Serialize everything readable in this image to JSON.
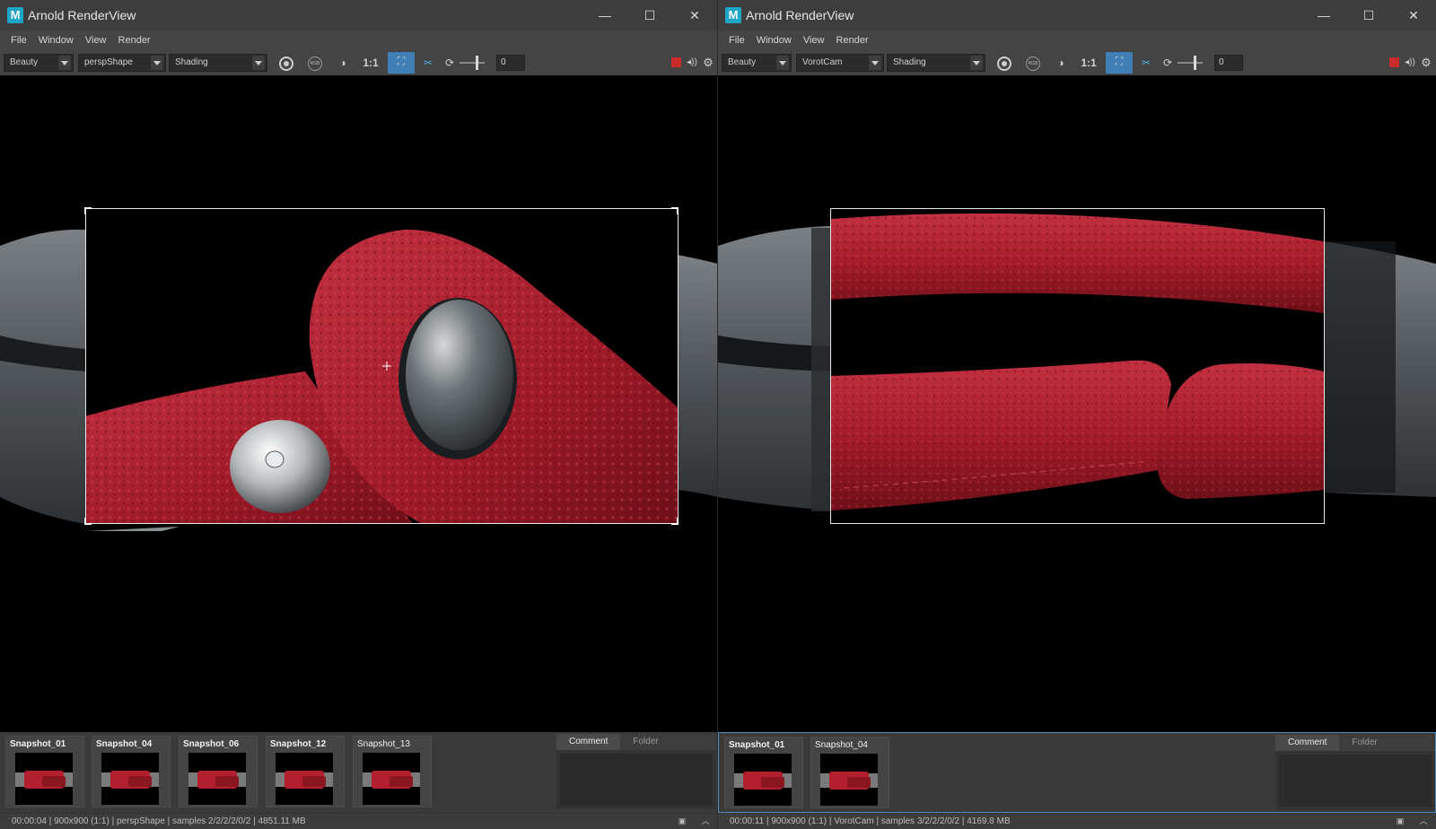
{
  "windows": [
    {
      "title": "Arnold RenderView",
      "logo_letter": "M",
      "window_controls": {
        "minimize": "—",
        "maximize": "☐",
        "close": "✕"
      },
      "menu": [
        "File",
        "Window",
        "View",
        "Render"
      ],
      "toolbar": {
        "aov": "Beauty",
        "camera": "perspShape",
        "debug_shading": "Shading",
        "ratio_label": "1:1",
        "exposure_value": "0"
      },
      "snapshots": [
        "Snapshot_01",
        "Snapshot_04",
        "Snapshot_06",
        "Snapshot_12",
        "Snapshot_13"
      ],
      "comment_tabs": [
        "Comment",
        "Folder"
      ],
      "status": "00:00:04 | 900x900 (1:1) | perspShape  | samples 2/2/2/2/0/2 | 4851.11 MB"
    },
    {
      "title": "Arnold RenderView",
      "logo_letter": "M",
      "window_controls": {
        "minimize": "—",
        "maximize": "☐",
        "close": "✕"
      },
      "menu": [
        "File",
        "Window",
        "View",
        "Render"
      ],
      "toolbar": {
        "aov": "Beauty",
        "camera": "VorotCam",
        "debug_shading": "Shading",
        "ratio_label": "1:1",
        "exposure_value": "0"
      },
      "snapshots": [
        "Snapshot_01",
        "Snapshot_04"
      ],
      "comment_tabs": [
        "Comment",
        "Folder"
      ],
      "status": "00:00:11 | 900x900 (1:1) | VorotCam  | samples 3/2/2/2/0/2 | 4169.8 MB"
    }
  ],
  "colors": {
    "leather_red": "#a51c2a",
    "strap_gray": "#5d6266",
    "active_tool": "#3f7fb5",
    "stop_red": "#c92a2a"
  }
}
